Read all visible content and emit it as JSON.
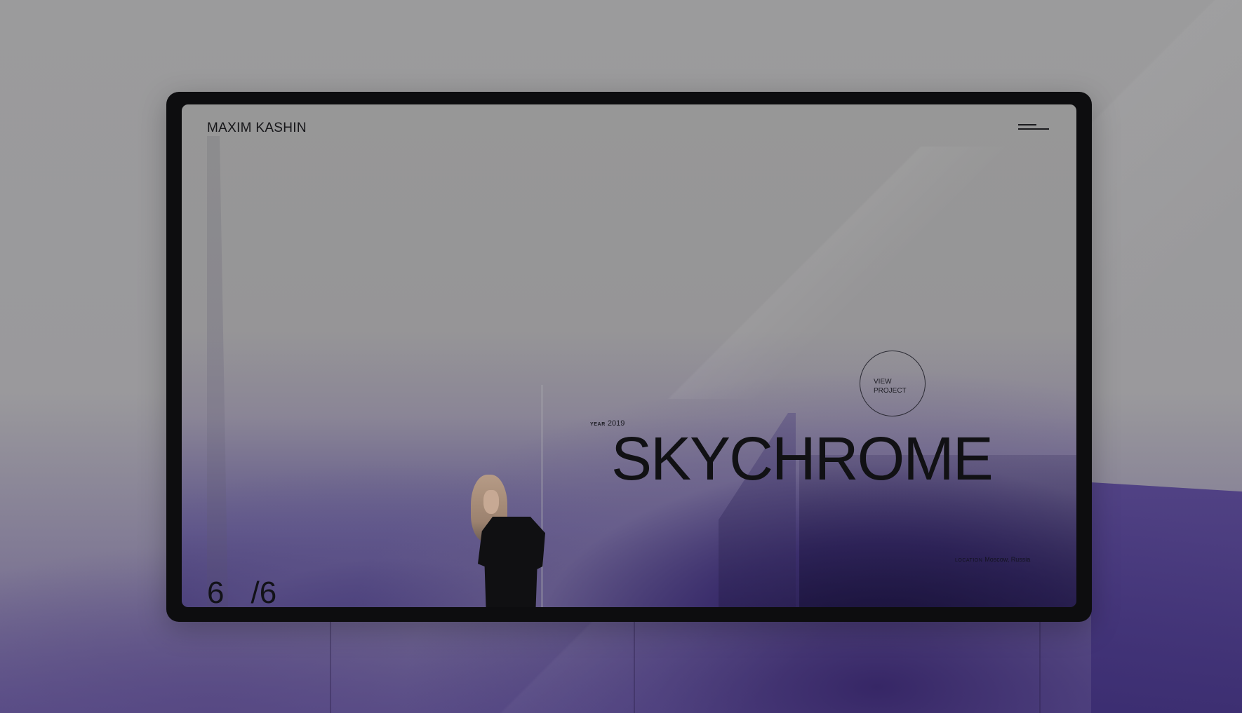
{
  "header": {
    "brand": "MAXIM KASHIN",
    "menu_icon": "hamburger-menu-icon"
  },
  "project": {
    "year_label": "YEAR",
    "year": "2019",
    "title": "SKYCHROME",
    "cta_label": "VIEW PROJECT",
    "location_label": "LOCATION",
    "location": "Moscow, Russia"
  },
  "pagination": {
    "current": "6",
    "total": "/6"
  },
  "colors": {
    "backdrop": "#9b9b9c",
    "frame": "#0d0d0f",
    "accent_purple": "#3b2e6c",
    "text": "#111114"
  }
}
